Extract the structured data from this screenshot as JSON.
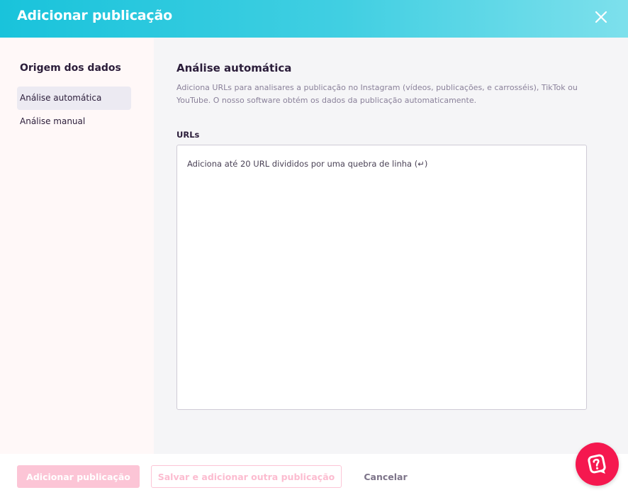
{
  "header": {
    "title": "Adicionar publicação",
    "close_icon": "close-icon"
  },
  "sidebar": {
    "heading": "Origem dos dados",
    "items": [
      {
        "label": "Análise automática",
        "active": true
      },
      {
        "label": "Análise manual",
        "active": false
      }
    ]
  },
  "main": {
    "title": "Análise automática",
    "description": "Adiciona URLs para analisares a publicação no Instagram (vídeos, publicações, e carrosséis), TikTok ou YouTube. O nosso software obtém os dados da publicação automaticamente.",
    "urls_label": "URLs",
    "urls_placeholder": "Adiciona até 20 URL divididos por uma quebra de linha (↵)",
    "urls_value": ""
  },
  "footer": {
    "add_label": "Adicionar publicação",
    "save_add_another_label": "Salvar e adicionar outra publicação",
    "cancel_label": "Cancelar"
  },
  "help_button": {
    "icon": "chat-help-icon"
  },
  "colors": {
    "header_gradient_start": "#19c3db",
    "header_gradient_end": "#7de0ec",
    "primary_pink": "#f5184f",
    "disabled_pink": "#fcc5d6",
    "text_dark": "#2b1d3a",
    "text_muted": "#8a819a"
  }
}
